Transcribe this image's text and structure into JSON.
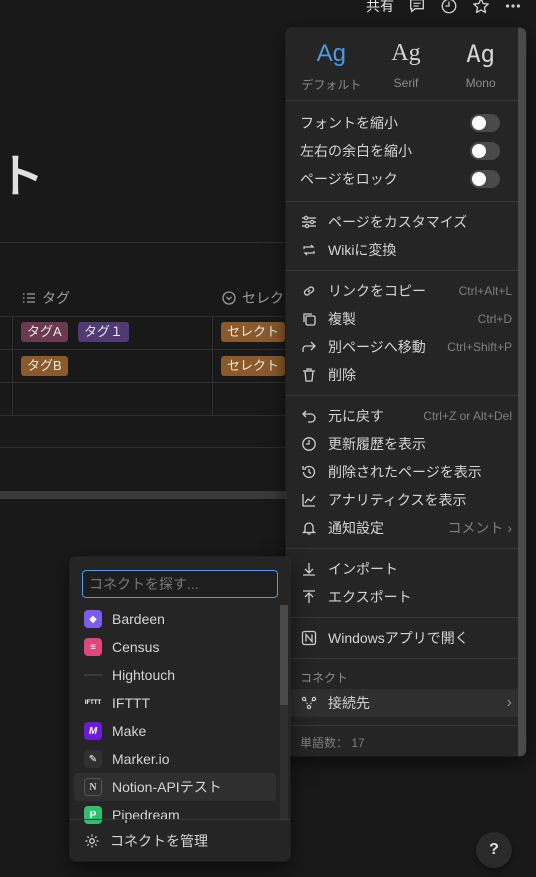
{
  "topbar": {
    "share": "共有"
  },
  "page": {
    "title_fragment": "ト",
    "columns": [
      {
        "label": "タグ",
        "icon": "list-icon"
      },
      {
        "label": "セレク",
        "icon": "select-icon"
      }
    ],
    "rows": [
      {
        "tags": [
          "タグA",
          "タグ１"
        ],
        "select": "セレクト"
      },
      {
        "tags": [
          "タグB"
        ],
        "select": "セレクト"
      }
    ],
    "colors": {
      "tagA": "#6b3a4e",
      "tag1": "#4f3a74",
      "tagB": "#8a5a2b",
      "select": "#8a5a2b"
    }
  },
  "menu": {
    "fonts": [
      {
        "sample": "Ag",
        "label": "デフォルト",
        "active": true
      },
      {
        "sample": "Ag",
        "label": "Serif",
        "active": false
      },
      {
        "sample": "Ag",
        "label": "Mono",
        "active": false
      }
    ],
    "toggles": [
      "フォントを縮小",
      "左右の余白を縮小",
      "ページをロック"
    ],
    "group1": [
      "ページをカスタマイズ",
      "Wikiに変換"
    ],
    "group2": [
      {
        "label": "リンクをコピー",
        "shortcut": "Ctrl+Alt+L"
      },
      {
        "label": "複製",
        "shortcut": "Ctrl+D"
      },
      {
        "label": "別ページへ移動",
        "shortcut": "Ctrl+Shift+P"
      },
      {
        "label": "削除",
        "shortcut": ""
      }
    ],
    "group3": [
      {
        "label": "元に戻す",
        "shortcut": "Ctrl+Z or Alt+Del"
      },
      {
        "label": "更新履歴を表示",
        "shortcut": ""
      },
      {
        "label": "削除されたページを表示",
        "shortcut": ""
      },
      {
        "label": "アナリティクスを表示",
        "shortcut": ""
      },
      {
        "label": "通知設定",
        "shortcut": "コメント"
      }
    ],
    "group4": [
      "インポート",
      "エクスポート"
    ],
    "open_app": "Windowsアプリで開く",
    "connect_section": "コネクト",
    "connect_item": "接続先",
    "word_count": "単語数： 17"
  },
  "connect": {
    "search_placeholder": "コネクトを探す...",
    "items": [
      {
        "name": "Bardeen",
        "color": "#7b5cf0",
        "glyph": "◆"
      },
      {
        "name": "Census",
        "color": "#e0457b",
        "glyph": "≡"
      },
      {
        "name": "Hightouch",
        "color": "#252525",
        "glyph": ""
      },
      {
        "name": "IFTTT",
        "color": "#252525",
        "glyph": "IFTTT"
      },
      {
        "name": "Make",
        "color": "#6e1ad9",
        "glyph": "M"
      },
      {
        "name": "Marker.io",
        "color": "#303030",
        "glyph": "✎"
      },
      {
        "name": "Notion-APIテスト",
        "color": "#303030",
        "glyph": "N"
      },
      {
        "name": "Pipedream",
        "color": "#2fbf71",
        "glyph": "P"
      }
    ],
    "manage": "コネクトを管理"
  },
  "help": "?"
}
